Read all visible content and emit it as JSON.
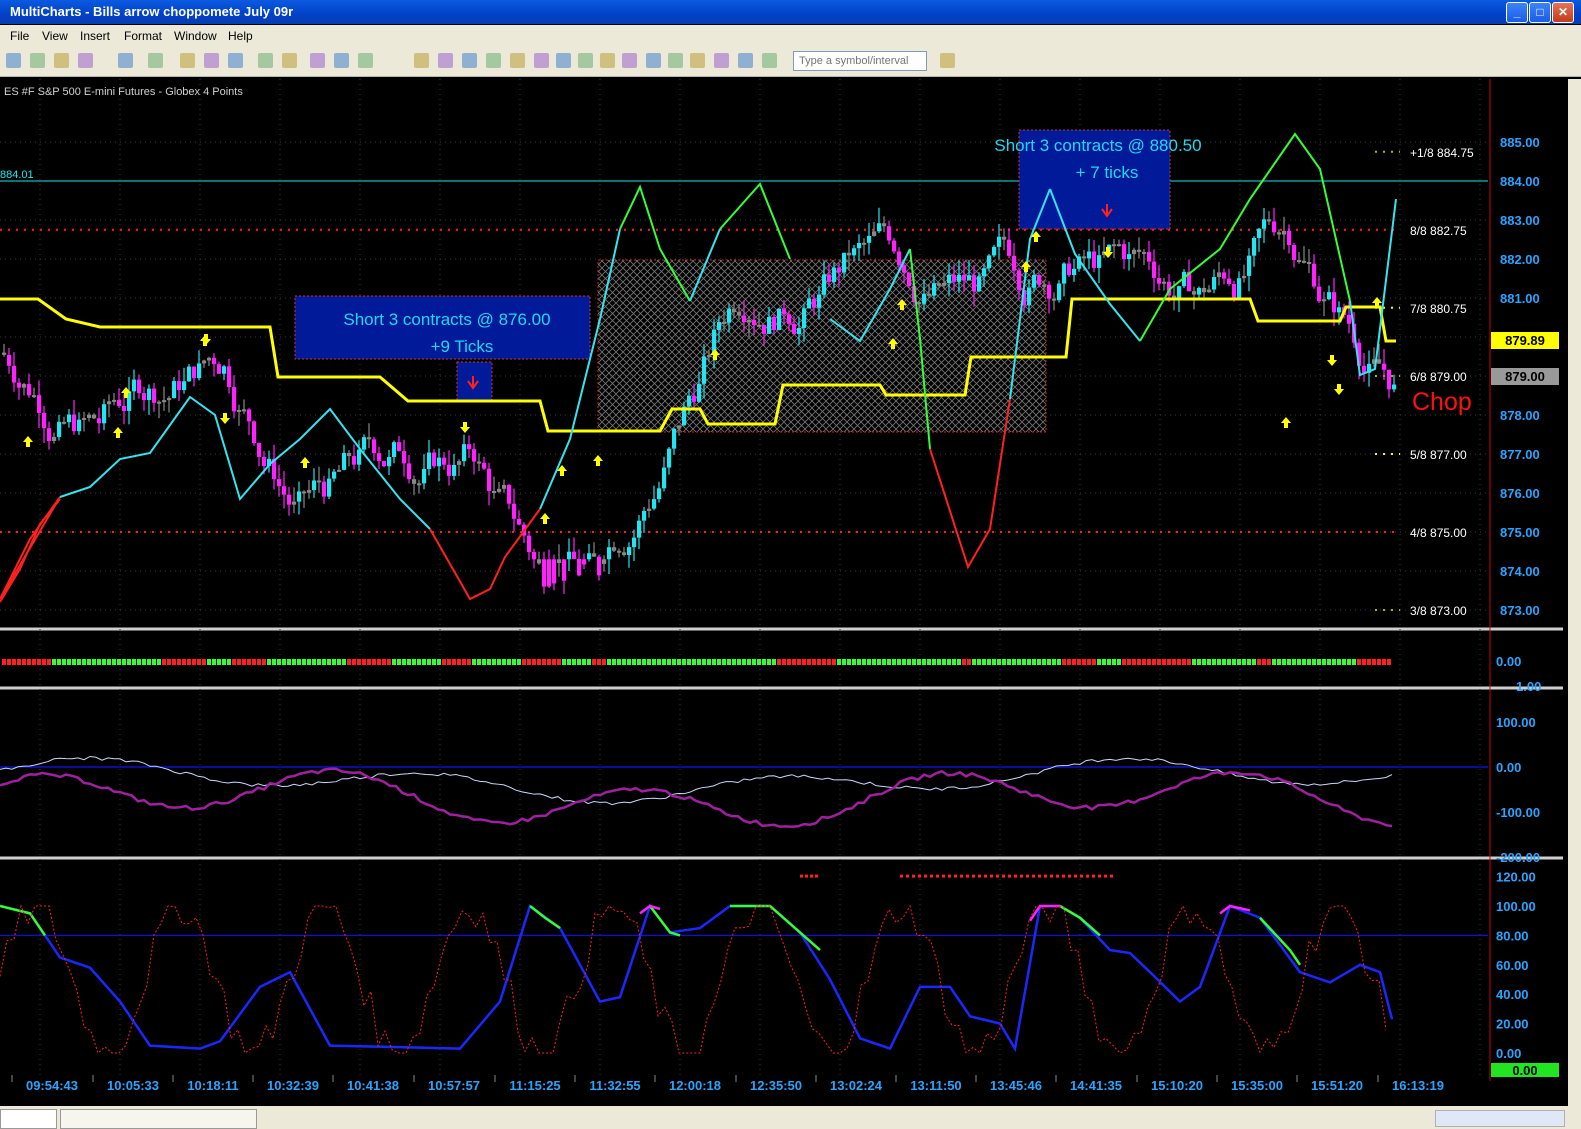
{
  "window": {
    "title": "MultiCharts - Bills arrow choppomete July 09r"
  },
  "menu": [
    "File",
    "View",
    "Insert",
    "Format",
    "Window",
    "Help"
  ],
  "toolbar": {
    "symbol_placeholder": "Type a symbol/interval"
  },
  "chart": {
    "instrument": "ES #F  S&P 500 E-mini Futures - Globex  4 Points",
    "hline_label": "884.01",
    "price_axis": [
      "885.00",
      "884.00",
      "883.00",
      "882.00",
      "881.00",
      "880.00",
      "879.00",
      "878.00",
      "877.00",
      "876.00",
      "875.00",
      "874.00",
      "873.00"
    ],
    "murrey": [
      {
        "label": "+1/8 884.75",
        "color": "#aab800"
      },
      {
        "label": "8/8  882.75",
        "color": "#ff2020"
      },
      {
        "label": "7/8  880.75",
        "color": "#ffff00"
      },
      {
        "label": "6/8  879.00",
        "color": "#aab800"
      },
      {
        "label": "5/8  877.00",
        "color": "#ffff00"
      },
      {
        "label": "4/8  875.00",
        "color": "#ff2020"
      },
      {
        "label": "3/8  873.00",
        "color": "#aab800"
      }
    ],
    "last_price_label": "879.89",
    "gray_price_label": "879.00",
    "chop_label": "Chop",
    "annotation1": {
      "line1": "Short 3 contracts @ 876.00",
      "line2": "+9 Ticks"
    },
    "annotation2": {
      "line1": "Short 3 contracts @ 880.50",
      "line2": "+ 7 ticks"
    }
  },
  "pane2": {
    "axis": [
      "0.00",
      "1.00"
    ]
  },
  "pane3": {
    "axis": [
      "100.00",
      "0.00",
      "-100.00",
      "-200.00"
    ]
  },
  "pane4": {
    "axis": [
      "120.00",
      "100.00",
      "80.00",
      "60.00",
      "40.00",
      "20.00",
      "0.00"
    ],
    "last_label": "0.00"
  },
  "time_axis": [
    "09:54:43",
    "10:05:33",
    "10:18:11",
    "10:32:39",
    "10:41:38",
    "10:57:57",
    "11:15:25",
    "11:32:55",
    "12:00:18",
    "12:35:50",
    "13:02:24",
    "13:11:50",
    "13:45:46",
    "14:41:35",
    "15:10:20",
    "15:35:00",
    "15:51:20",
    "16:13:19"
  ],
  "colors": {
    "up_bar": "#22e5f0",
    "down_bar": "#ff22ff",
    "neutral_bar": "#888888",
    "murrey_yellow": "#ffff00",
    "signal_green": "#33ff33",
    "signal_red": "#ff2020",
    "chop_red": "#ff1010"
  },
  "icons": [
    "minimize-icon",
    "maximize-icon",
    "close-icon",
    "arrow-pointer-icon",
    "crosshair-icon",
    "zoom-in-icon",
    "zoom-out-icon"
  ]
}
